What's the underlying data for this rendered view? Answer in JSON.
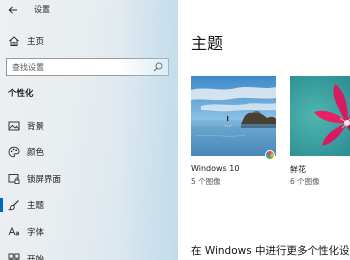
{
  "window": {
    "title": "设置"
  },
  "sidebar": {
    "home_label": "主页",
    "search_placeholder": "查找设置",
    "section_title": "个性化",
    "items": [
      {
        "label": "背景",
        "icon": "background-image-icon"
      },
      {
        "label": "颜色",
        "icon": "palette-icon"
      },
      {
        "label": "锁屏界面",
        "icon": "lock-screen-icon"
      },
      {
        "label": "主题",
        "icon": "brush-icon",
        "selected": true
      },
      {
        "label": "字体",
        "icon": "font-icon"
      },
      {
        "label": "开始",
        "icon": "start-icon"
      }
    ]
  },
  "main": {
    "title": "主题",
    "themes": [
      {
        "name": "Windows 10",
        "count": "5 个图像"
      },
      {
        "name": "鲜花",
        "count": "6 个图像"
      }
    ],
    "footer_text": "在 Windows 中进行更多个性化设"
  },
  "colors": {
    "accent": "#0067c0"
  }
}
